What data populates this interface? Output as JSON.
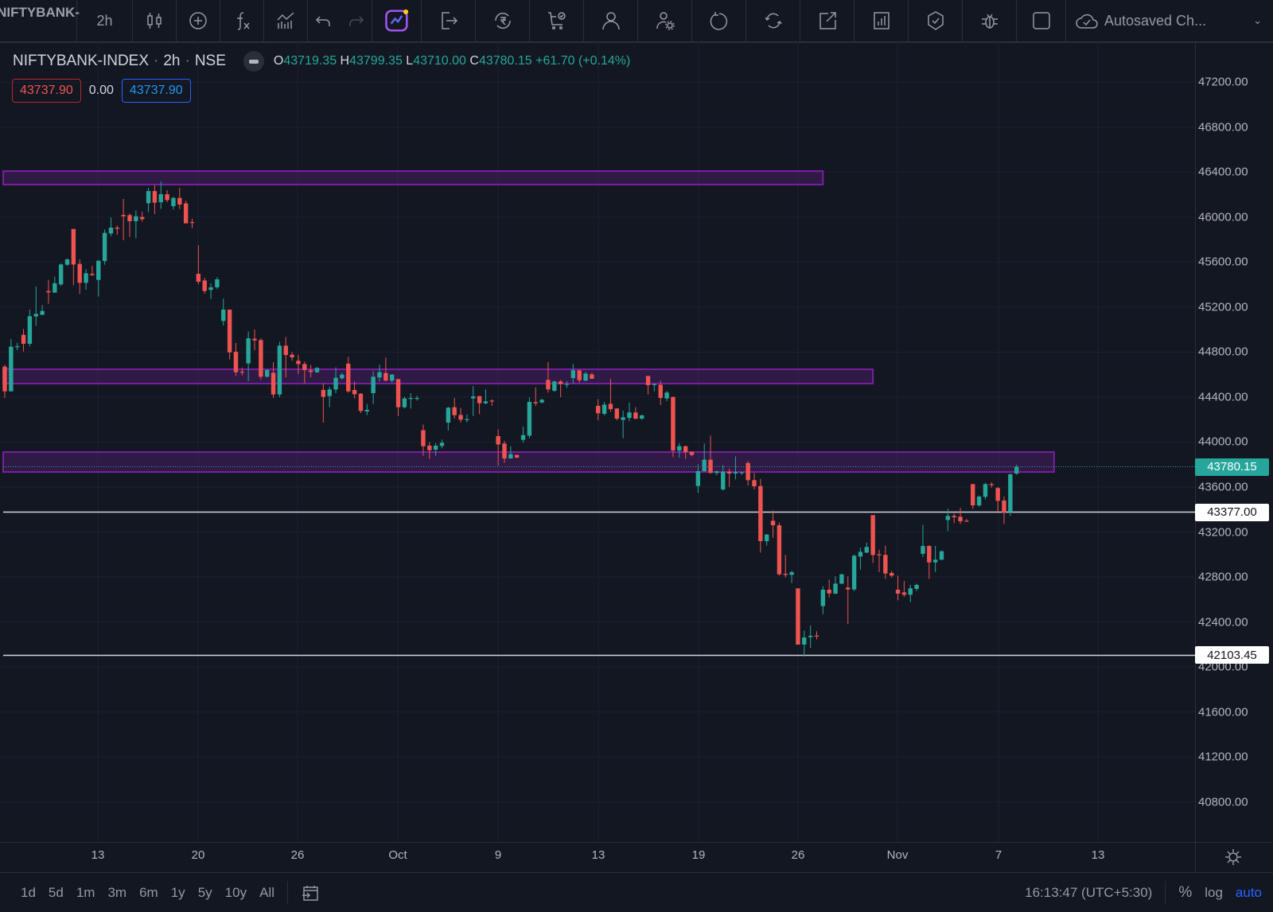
{
  "toolbar": {
    "symbol": "NIFTYBANK-I",
    "interval": "2h",
    "autosave_label": "Autosaved Ch...",
    "icons": [
      "candles-icon",
      "add-indicator-icon",
      "function-icon",
      "indicators-icon",
      "undo-icon",
      "redo-icon",
      "ai-chart-icon",
      "export-icon",
      "rupee-refresh-icon",
      "cart-icon",
      "person-icon",
      "person-gear-icon",
      "rotate-icon",
      "refresh-icon",
      "external-link-icon",
      "bar-chart-icon",
      "shield-check-icon",
      "bug-icon",
      "square-icon",
      "cloud-check-icon",
      "chevron-down-icon"
    ]
  },
  "legend": {
    "symbol": "NIFTYBANK-INDEX",
    "interval": "2h",
    "exchange": "NSE",
    "o_label": "O",
    "o": "43719.35",
    "h_label": "H",
    "h": "43799.35",
    "l_label": "L",
    "l": "43710.00",
    "c_label": "C",
    "c": "43780.15",
    "change": "+61.70 (+0.14%)",
    "sell_price": "43737.90",
    "spread": "0.00",
    "buy_price": "43737.90"
  },
  "colors": {
    "up": "#26a69a",
    "down": "#ef5350",
    "zone": "#7b1fa2",
    "background": "#131722"
  },
  "price_axis": {
    "labels": [
      "47200.00",
      "46800.00",
      "46400.00",
      "46000.00",
      "45600.00",
      "45200.00",
      "44800.00",
      "44400.00",
      "44000.00",
      "43600.00",
      "43200.00",
      "42800.00",
      "42400.00",
      "42000.00",
      "41600.00",
      "41200.00",
      "40800.00"
    ],
    "last_price": "43780.15",
    "line1": "43377.00",
    "line2": "42103.45"
  },
  "time_axis": {
    "labels": [
      "13",
      "20",
      "26",
      "Oct",
      "9",
      "13",
      "19",
      "26",
      "Nov",
      "7",
      "13"
    ]
  },
  "bottom": {
    "ranges": [
      "1d",
      "5d",
      "1m",
      "3m",
      "6m",
      "1y",
      "5y",
      "10y",
      "All"
    ],
    "clock": "16:13:47 (UTC+5:30)",
    "percent": "%",
    "log": "log",
    "auto": "auto"
  },
  "chart_data": {
    "type": "candlestick",
    "ylim": [
      40800,
      47200
    ],
    "horizontal_lines": [
      43377.0,
      42103.45
    ],
    "last_close": 43780.15,
    "zones": [
      {
        "low": 46290,
        "high": 46410,
        "end_candle": 131
      },
      {
        "low": 44520,
        "high": 44647,
        "end_candle": 139
      },
      {
        "low": 43734,
        "high": 43911,
        "end_candle": 168
      }
    ],
    "candles_ohlc": [
      [
        44671,
        44687,
        44392,
        44451
      ],
      [
        44451,
        44916,
        44451,
        44848
      ],
      [
        44845,
        44883,
        44817,
        44852
      ],
      [
        44954,
        45006,
        44805,
        44874
      ],
      [
        44874,
        45178,
        44852,
        45119
      ],
      [
        45117,
        45383,
        45034,
        45140
      ],
      [
        45131,
        45218,
        45131,
        45166
      ],
      [
        45343,
        45442,
        45230,
        45331
      ],
      [
        45329,
        45471,
        45329,
        45412
      ],
      [
        45402,
        45588,
        45388,
        45579
      ],
      [
        45577,
        45633,
        45567,
        45624
      ],
      [
        45895,
        45895,
        45395,
        45579
      ],
      [
        45584,
        45624,
        45317,
        45416
      ],
      [
        45416,
        45537,
        45355,
        45501
      ],
      [
        45496,
        45567,
        45478,
        45485
      ],
      [
        45442,
        45619,
        45294,
        45612
      ],
      [
        45610,
        45890,
        45577,
        45860
      ],
      [
        45855,
        45997,
        45831,
        45907
      ],
      [
        45907,
        45926,
        45843,
        45897
      ],
      [
        46020,
        46162,
        45796,
        46008
      ],
      [
        46018,
        46032,
        45824,
        45964
      ],
      [
        45964,
        46060,
        45813,
        46008
      ],
      [
        46001,
        46048,
        45961,
        45982
      ],
      [
        46124,
        46261,
        46044,
        46232
      ],
      [
        46232,
        46284,
        46027,
        46129
      ],
      [
        46133,
        46315,
        46074,
        46204
      ],
      [
        46204,
        46240,
        46133,
        46152
      ],
      [
        46098,
        46181,
        46067,
        46171
      ],
      [
        46171,
        46261,
        46072,
        46112
      ],
      [
        46122,
        46148,
        45945,
        45945
      ],
      [
        45956,
        45985,
        45902,
        45949
      ],
      [
        45496,
        45749,
        45402,
        45426
      ],
      [
        45437,
        45461,
        45320,
        45343
      ],
      [
        45353,
        45412,
        45272,
        45376
      ],
      [
        45376,
        45466,
        45360,
        45447
      ],
      [
        45077,
        45277,
        45036,
        45178
      ],
      [
        45178,
        45178,
        44735,
        44798
      ],
      [
        44803,
        44881,
        44588,
        44621
      ],
      [
        44626,
        44661,
        44593,
        44619
      ],
      [
        44699,
        44982,
        44541,
        44923
      ],
      [
        44919,
        45001,
        44817,
        44904
      ],
      [
        44907,
        44923,
        44553,
        44581
      ],
      [
        44581,
        44647,
        44574,
        44640
      ],
      [
        44616,
        44711,
        44392,
        44423
      ],
      [
        44423,
        44892,
        44399,
        44857
      ],
      [
        44857,
        44935,
        44576,
        44774
      ],
      [
        44777,
        44800,
        44723,
        44753
      ],
      [
        44723,
        44774,
        44605,
        44694
      ],
      [
        44694,
        44715,
        44522,
        44640
      ],
      [
        44638,
        44685,
        44576,
        44623
      ],
      [
        44621,
        44666,
        44616,
        44659
      ],
      [
        44463,
        44522,
        44173,
        44402
      ],
      [
        44409,
        44491,
        44310,
        44468
      ],
      [
        44468,
        44664,
        44435,
        44572
      ],
      [
        44567,
        44616,
        44553,
        44600
      ],
      [
        44697,
        44758,
        44439,
        44451
      ],
      [
        44463,
        44539,
        44388,
        44425
      ],
      [
        44430,
        44435,
        44258,
        44277
      ],
      [
        44272,
        44338,
        44239,
        44286
      ],
      [
        44435,
        44628,
        44338,
        44581
      ],
      [
        44574,
        44687,
        44539,
        44621
      ],
      [
        44614,
        44751,
        44541,
        44546
      ],
      [
        44546,
        44605,
        44527,
        44600
      ],
      [
        44560,
        44562,
        44232,
        44310
      ],
      [
        44310,
        44404,
        44298,
        44388
      ],
      [
        44388,
        44435,
        44298,
        44392
      ],
      [
        44390,
        44411,
        44369,
        44392
      ],
      [
        44105,
        44156,
        43878,
        43963
      ],
      [
        43968,
        43998,
        43850,
        43928
      ],
      [
        43932,
        43991,
        43878,
        43968
      ],
      [
        43965,
        44022,
        43944,
        43994
      ],
      [
        44173,
        44314,
        44102,
        44305
      ],
      [
        44310,
        44392,
        44208,
        44239
      ],
      [
        44241,
        44303,
        44175,
        44199
      ],
      [
        44201,
        44246,
        44175,
        44204
      ],
      [
        44388,
        44498,
        44232,
        44406
      ],
      [
        44409,
        44411,
        44248,
        44345
      ],
      [
        44345,
        44468,
        44336,
        44362
      ],
      [
        44369,
        44380,
        44322,
        44362
      ],
      [
        44053,
        44114,
        43791,
        43979
      ],
      [
        43987,
        44010,
        43814,
        43854
      ],
      [
        43854,
        43963,
        43854,
        43892
      ],
      [
        43885,
        43890,
        43857,
        43862
      ],
      [
        44020,
        44138,
        43996,
        44062
      ],
      [
        44057,
        44397,
        44034,
        44357
      ],
      [
        44355,
        44487,
        44322,
        44345
      ],
      [
        44352,
        44385,
        44345,
        44376
      ],
      [
        44553,
        44711,
        44440,
        44468
      ],
      [
        44456,
        44546,
        44447,
        44539
      ],
      [
        44539,
        44553,
        44399,
        44515
      ],
      [
        44515,
        44541,
        44482,
        44517
      ],
      [
        44569,
        44694,
        44522,
        44638
      ],
      [
        44638,
        44642,
        44527,
        44550
      ],
      [
        44546,
        44624,
        44541,
        44609
      ],
      [
        44602,
        44616,
        44562,
        44562
      ],
      [
        44322,
        44381,
        44194,
        44256
      ],
      [
        44251,
        44357,
        44237,
        44333
      ],
      [
        44340,
        44562,
        44270,
        44293
      ],
      [
        44298,
        44303,
        44194,
        44208
      ],
      [
        44197,
        44279,
        44034,
        44220
      ],
      [
        44215,
        44352,
        44185,
        44263
      ],
      [
        44263,
        44310,
        44204,
        44208
      ],
      [
        44208,
        44244,
        44199,
        44237
      ],
      [
        44588,
        44588,
        44423,
        44506
      ],
      [
        44510,
        44524,
        44451,
        44515
      ],
      [
        44510,
        44546,
        44329,
        44392
      ],
      [
        44388,
        44454,
        44364,
        44440
      ],
      [
        44402,
        44402,
        43866,
        43925
      ],
      [
        43925,
        43991,
        43862,
        43963
      ],
      [
        43963,
        43968,
        43850,
        43909
      ],
      [
        43914,
        43916,
        43873,
        43885
      ],
      [
        43609,
        43803,
        43548,
        43741
      ],
      [
        43741,
        43987,
        43737,
        43843
      ],
      [
        43843,
        44057,
        43720,
        43725
      ],
      [
        43725,
        43748,
        43704,
        43739
      ],
      [
        43579,
        43796,
        43567,
        43737
      ],
      [
        43737,
        43763,
        43602,
        43720
      ],
      [
        43720,
        43873,
        43668,
        43732
      ],
      [
        43727,
        43737,
        43708,
        43732
      ],
      [
        43814,
        43831,
        43614,
        43661
      ],
      [
        43661,
        43725,
        43579,
        43607
      ],
      [
        43609,
        43673,
        43017,
        43119
      ],
      [
        43119,
        43182,
        43079,
        43178
      ],
      [
        43300,
        43390,
        43149,
        43260
      ],
      [
        43260,
        43284,
        42812,
        42824
      ],
      [
        42829,
        42996,
        42796,
        42819
      ],
      [
        42819,
        42855,
        42746,
        42843
      ],
      [
        42699,
        42699,
        42199,
        42199
      ],
      [
        42199,
        42324,
        42093,
        42262
      ],
      [
        42265,
        42369,
        42170,
        42277
      ],
      [
        42279,
        42317,
        42246,
        42274
      ],
      [
        42541,
        42718,
        42470,
        42687
      ],
      [
        42687,
        42777,
        42619,
        42654
      ],
      [
        42652,
        42807,
        42647,
        42741
      ],
      [
        42741,
        42829,
        42737,
        42824
      ],
      [
        42706,
        42805,
        42380,
        42689
      ],
      [
        42689,
        43001,
        42675,
        42989
      ],
      [
        42982,
        43060,
        42866,
        43024
      ],
      [
        43017,
        43107,
        43013,
        43067
      ],
      [
        43350,
        43350,
        42925,
        42996
      ],
      [
        43001,
        43043,
        42843,
        42994
      ],
      [
        42996,
        43079,
        42784,
        42831
      ],
      [
        42836,
        42855,
        42796,
        42812
      ],
      [
        42687,
        42812,
        42593,
        42652
      ],
      [
        42663,
        42765,
        42623,
        42642
      ],
      [
        42642,
        42730,
        42576,
        42699
      ],
      [
        42694,
        42741,
        42675,
        42730
      ],
      [
        43006,
        43265,
        42977,
        43076
      ],
      [
        43076,
        43081,
        42784,
        42930
      ],
      [
        42930,
        43076,
        42843,
        42954
      ],
      [
        42954,
        43036,
        42949,
        43029
      ],
      [
        43307,
        43407,
        43208,
        43343
      ],
      [
        43343,
        43366,
        43279,
        43331
      ],
      [
        43336,
        43414,
        43272,
        43296
      ],
      [
        43300,
        43317,
        43291,
        43296
      ],
      [
        43626,
        43626,
        43407,
        43437
      ],
      [
        43437,
        43525,
        43425,
        43515
      ],
      [
        43513,
        43638,
        43489,
        43626
      ],
      [
        43626,
        43642,
        43595,
        43619
      ],
      [
        43591,
        43602,
        43366,
        43477
      ],
      [
        43480,
        43515,
        43272,
        43374
      ],
      [
        43378,
        43720,
        43343,
        43713
      ],
      [
        43719.35,
        43799.35,
        43710.0,
        43780.15
      ]
    ]
  }
}
